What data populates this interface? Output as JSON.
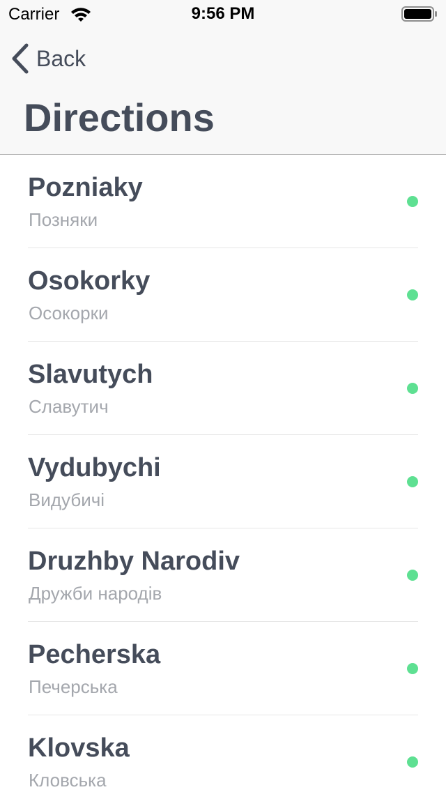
{
  "status_bar": {
    "carrier": "Carrier",
    "time": "9:56 PM",
    "wifi_icon": "wifi-icon",
    "battery_icon": "battery-icon"
  },
  "nav": {
    "back_label": "Back",
    "back_icon": "chevron-left-icon",
    "title": "Directions"
  },
  "colors": {
    "text_primary": "#454c5a",
    "text_secondary": "#a4a7ad",
    "status_active": "#5ee092",
    "nav_background": "#f8f8f8"
  },
  "stations": [
    {
      "name": "Pozniaky",
      "name_local": "Позняки",
      "status": "active"
    },
    {
      "name": "Osokorky",
      "name_local": "Осокорки",
      "status": "active"
    },
    {
      "name": "Slavutych",
      "name_local": "Славутич",
      "status": "active"
    },
    {
      "name": "Vydubychi",
      "name_local": "Видубичі",
      "status": "active"
    },
    {
      "name": "Druzhby Narodiv",
      "name_local": "Дружби народів",
      "status": "active"
    },
    {
      "name": "Pecherska",
      "name_local": "Печерська",
      "status": "active"
    },
    {
      "name": "Klovska",
      "name_local": "Кловська",
      "status": "active"
    }
  ]
}
